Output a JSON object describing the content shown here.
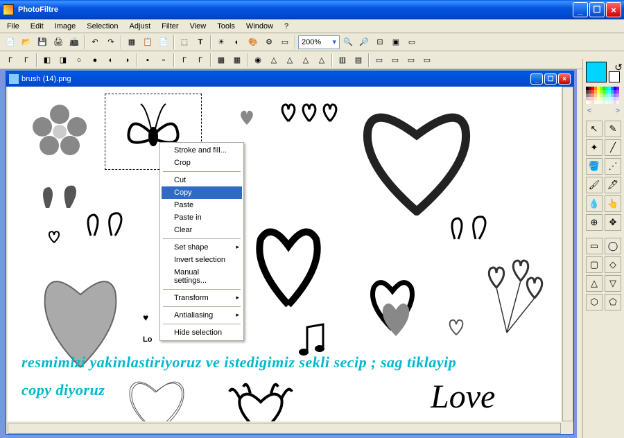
{
  "app": {
    "title": "PhotoFiltre"
  },
  "menus": [
    "File",
    "Edit",
    "Image",
    "Selection",
    "Adjust",
    "Filter",
    "View",
    "Tools",
    "Window",
    "?"
  ],
  "zoom": {
    "value": "200%"
  },
  "document": {
    "title": "brush (14).png"
  },
  "context_menu": {
    "items": [
      {
        "label": "Stroke and fill...",
        "type": "item"
      },
      {
        "label": "Crop",
        "type": "item"
      },
      {
        "type": "sep"
      },
      {
        "label": "Cut",
        "type": "item"
      },
      {
        "label": "Copy",
        "type": "item",
        "highlighted": true
      },
      {
        "label": "Paste",
        "type": "item"
      },
      {
        "label": "Paste in",
        "type": "item"
      },
      {
        "label": "Clear",
        "type": "item"
      },
      {
        "type": "sep"
      },
      {
        "label": "Set shape",
        "type": "sub"
      },
      {
        "label": "Invert selection",
        "type": "item"
      },
      {
        "label": "Manual settings...",
        "type": "item"
      },
      {
        "type": "sep"
      },
      {
        "label": "Transform",
        "type": "sub"
      },
      {
        "type": "sep"
      },
      {
        "label": "Antialiasing",
        "type": "sub"
      },
      {
        "type": "sep"
      },
      {
        "label": "Hide selection",
        "type": "item"
      }
    ]
  },
  "overlay": {
    "line1": "resmimizi yakinlastiriyoruz ve istedigimiz sekli secip ; sag tiklayip",
    "line2": "copy diyoruz"
  },
  "canvas_text": {
    "love1": "Lo",
    "love2": "Love"
  },
  "palette_nav": {
    "prev": "<",
    "next": ">"
  },
  "colors": {
    "fg": "#00d4ff",
    "bg": "#ffffff"
  }
}
